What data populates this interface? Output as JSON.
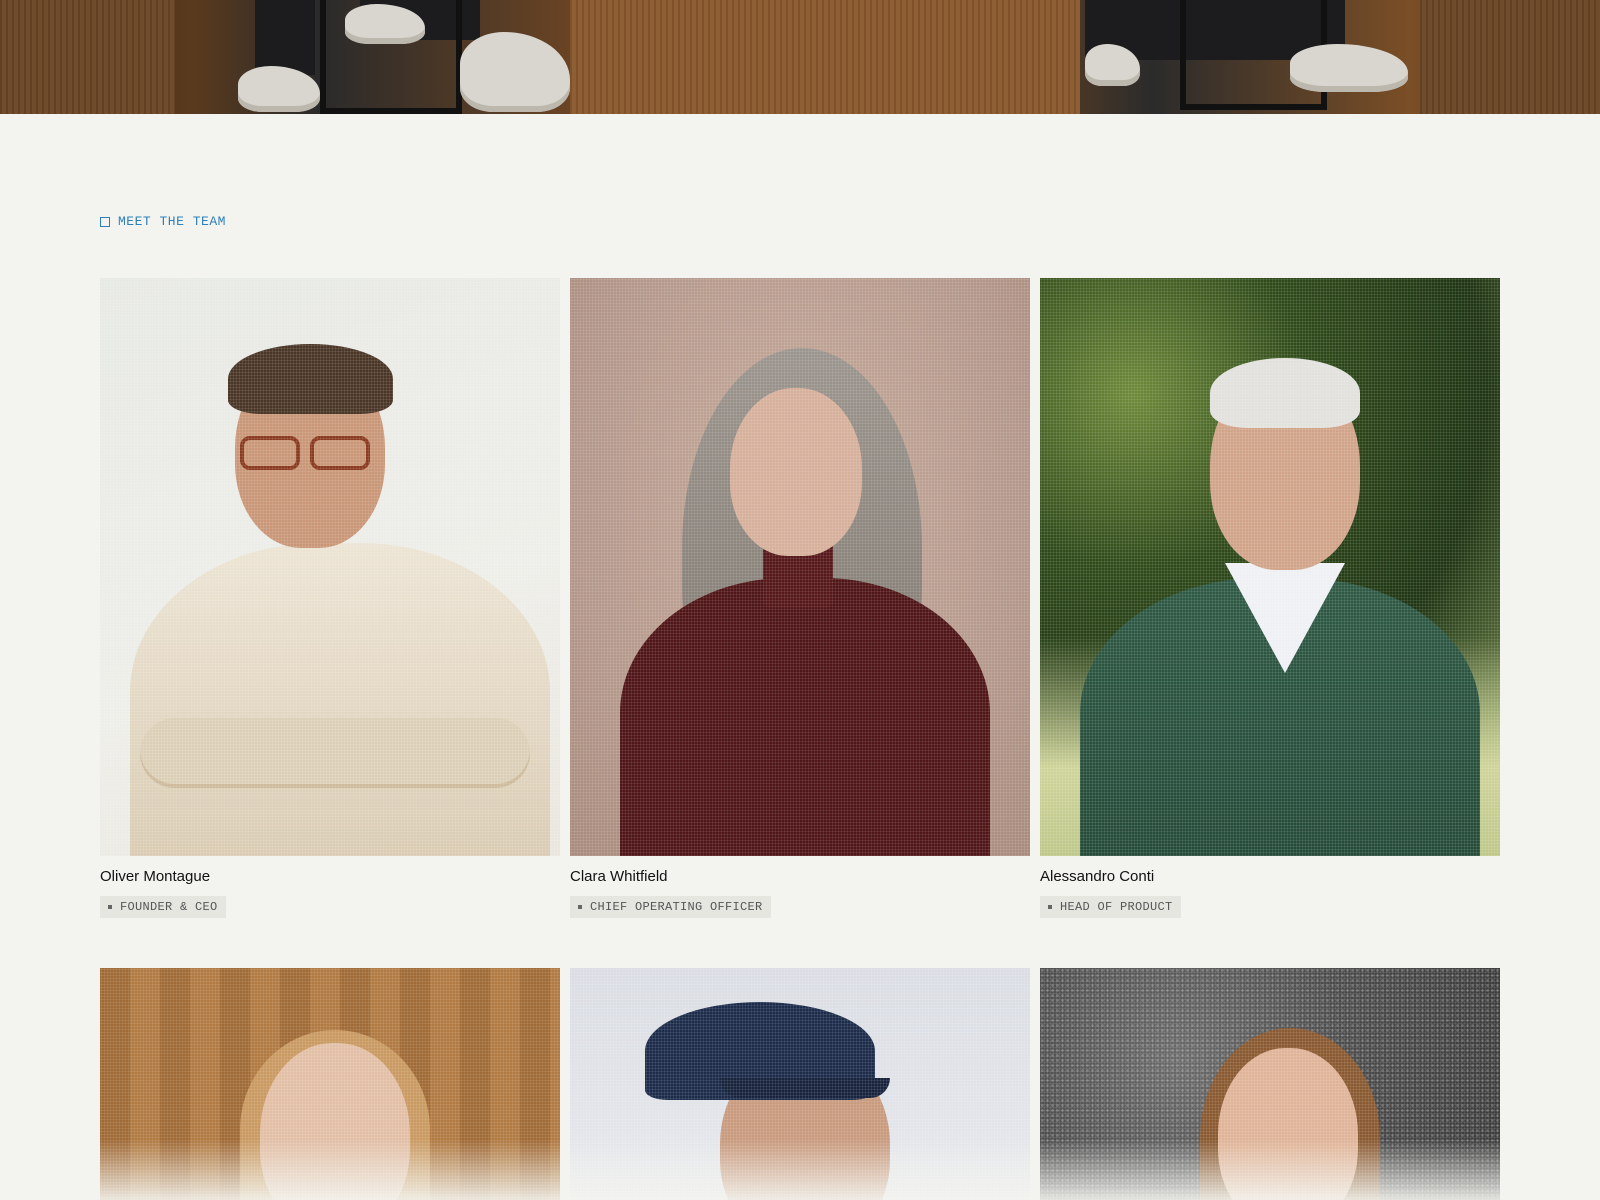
{
  "section": {
    "label": "MEET THE TEAM",
    "accent_color": "#2f7fb8",
    "icon": "square-outline-icon"
  },
  "team": [
    {
      "name": "Oliver Montague",
      "role": "FOUNDER & CEO"
    },
    {
      "name": "Clara Whitfield",
      "role": "CHIEF OPERATING OFFICER"
    },
    {
      "name": "Alessandro Conti",
      "role": "HEAD OF PRODUCT"
    }
  ],
  "colors": {
    "page_background": "#f3f4ef",
    "role_badge_background": "#e6e6e1"
  }
}
